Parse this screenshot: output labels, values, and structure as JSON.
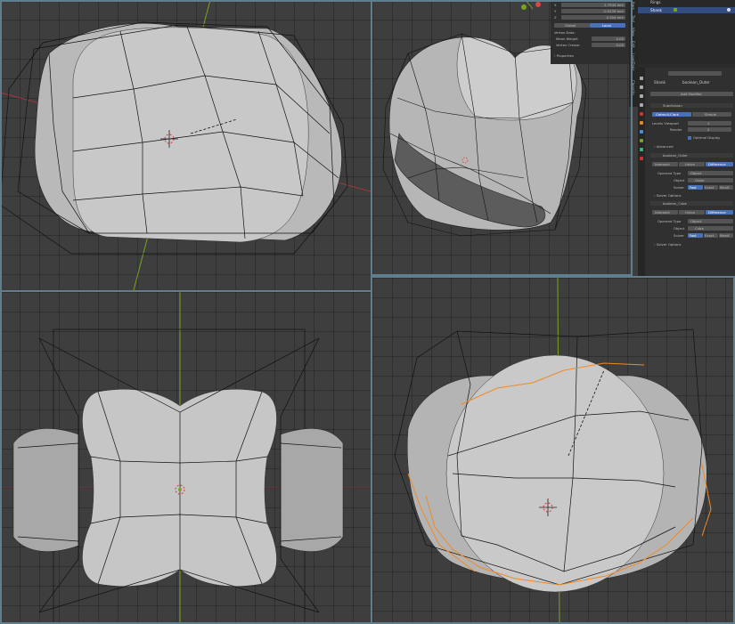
{
  "outliner": {
    "rows": [
      {
        "name": "Rings"
      },
      {
        "name": "Shank"
      }
    ]
  },
  "transform": {
    "x": "2.7544 mm",
    "y": "-0.9139 mm",
    "z": "4.394 mm",
    "global": "Global",
    "local": "Local"
  },
  "vertex_data": {
    "title": "Vertex Data:",
    "mean_weight_label": "Mean Weight",
    "mean_weight": "0.00",
    "vertex_crease_label": "Vertex Crease",
    "vertex_crease": "0.00"
  },
  "properties_label": "Properties",
  "sidebar_tabs": [
    "Item",
    "Tool",
    "View",
    "Edit",
    "LoopTools",
    "CleanUp"
  ],
  "props": {
    "search_placeholder": "",
    "breadcrumb_obj": "Shank",
    "breadcrumb_mod": "boolean_Outer",
    "add_modifier": "Add Modifier",
    "subsurf": {
      "name": "Subdivision",
      "catmull": "Catmull-Clark",
      "simple": "Simple",
      "levels_label": "Levels Viewport",
      "levels": "1",
      "render_label": "Render",
      "render": "2",
      "optimal": "Optimal Display",
      "advanced": "Advanced"
    },
    "bool1": {
      "name": "boolean_Outer",
      "intersect": "Intersect",
      "union": "Union",
      "difference": "Difference",
      "operand_label": "Operand Type",
      "operand": "Object",
      "object_label": "Object",
      "object": "Outer",
      "solver_label": "Solver",
      "fast": "Fast",
      "exact": "Exact",
      "manifold": "Manif.",
      "solver_options": "Solver Options"
    },
    "bool2": {
      "name": "boolean_Cube",
      "intersect": "Intersect",
      "union": "Union",
      "difference": "Difference",
      "operand_label": "Operand Type",
      "operand": "Object",
      "object_label": "Object",
      "object": "Cube",
      "solver_label": "Solver",
      "fast": "Fast",
      "exact": "Exact",
      "manifold": "Manif.",
      "solver_options": "Solver Options"
    }
  },
  "colors": {
    "viewport_bg": "#3e3e3e",
    "mesh": "#c4c4c4",
    "wire": "#111111",
    "selected": "#f08a24",
    "y_axis": "#7aa320",
    "x_axis": "#9c3a3f",
    "frame": "#5f7e8e",
    "accent": "#4772b3"
  }
}
